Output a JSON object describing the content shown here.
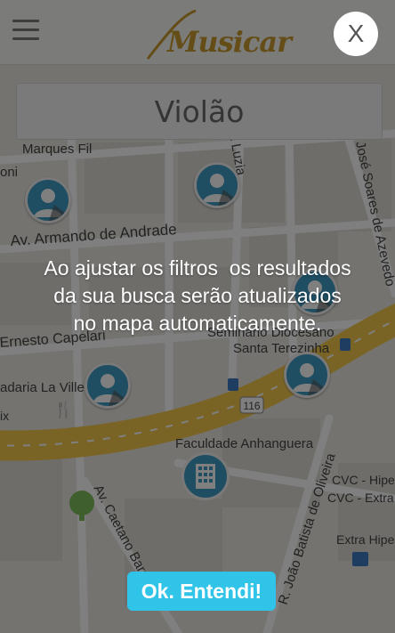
{
  "header": {
    "brand": "Musicar",
    "menu_icon": "hamburger-menu-icon"
  },
  "search": {
    "value": "Violão"
  },
  "map": {
    "labels": {
      "marques": "Marques Fil",
      "oni": "oni",
      "armando": "Av. Armando de Andrade",
      "ernesto": "Ernesto Capelari",
      "seminario": "Seminário Diocesano",
      "santa": "Santa Terezinha",
      "padaria": "adaria La Ville",
      "faculdade": "Faculdade Anhanguera",
      "cvc": "CVC - Hipe",
      "cvc2": "CVC - Extra Taboã",
      "extra": "Extra Hipe",
      "caetano": "Av. Caetano Barrella",
      "joao": "R. João Batista de Oliveira",
      "jose": "José Soares de Azevedo",
      "luzia": "a Luzia",
      "road": "116",
      "ix": "ix"
    },
    "colors": {
      "background": "#e9e6df",
      "highway": "#f2c94c",
      "pin": "#3e9bc3"
    }
  },
  "overlay": {
    "tip_lines": [
      "Ao ajustar os filtros  os resultados",
      "da sua busca serão atualizados",
      "no mapa automaticamente."
    ],
    "close_label": "X",
    "ok_label": "Ok. Entendi!"
  }
}
